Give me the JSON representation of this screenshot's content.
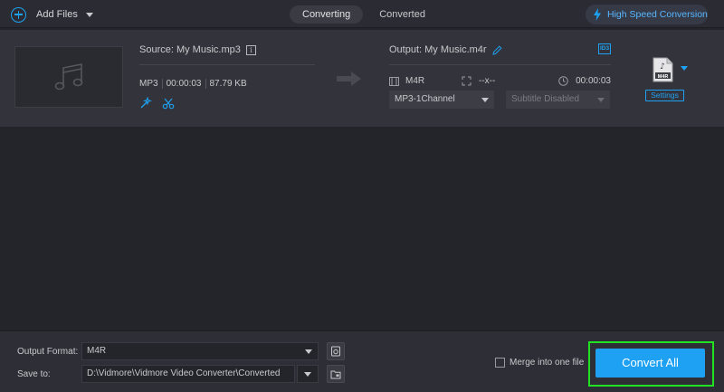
{
  "topbar": {
    "add_files_label": "Add Files",
    "tabs": [
      {
        "label": "Converting",
        "active": true
      },
      {
        "label": "Converted",
        "active": false
      }
    ],
    "high_speed_label": "High Speed Conversion"
  },
  "file": {
    "source_name": "Source: My Music.mp3",
    "source_format": "MP3",
    "source_duration": "00:00:03",
    "source_size": "87.79 KB",
    "output_name": "Output: My Music.m4r",
    "output_format": "M4R",
    "output_resolution": "--x--",
    "output_duration": "00:00:03",
    "audio_track": "MP3-1Channel",
    "subtitle": "Subtitle Disabled",
    "id3_badge": "ID3",
    "format_icon_label": "M4R",
    "settings_label": "Settings"
  },
  "bottom": {
    "output_format_label": "Output Format:",
    "output_format_value": "M4R",
    "save_to_label": "Save to:",
    "save_to_value": "D:\\Vidmore\\Vidmore Video Converter\\Converted",
    "merge_label": "Merge into one file",
    "convert_all_label": "Convert All"
  },
  "colors": {
    "accent": "#1ea1f2",
    "highlight": "#22e022",
    "background": "#24252b"
  }
}
